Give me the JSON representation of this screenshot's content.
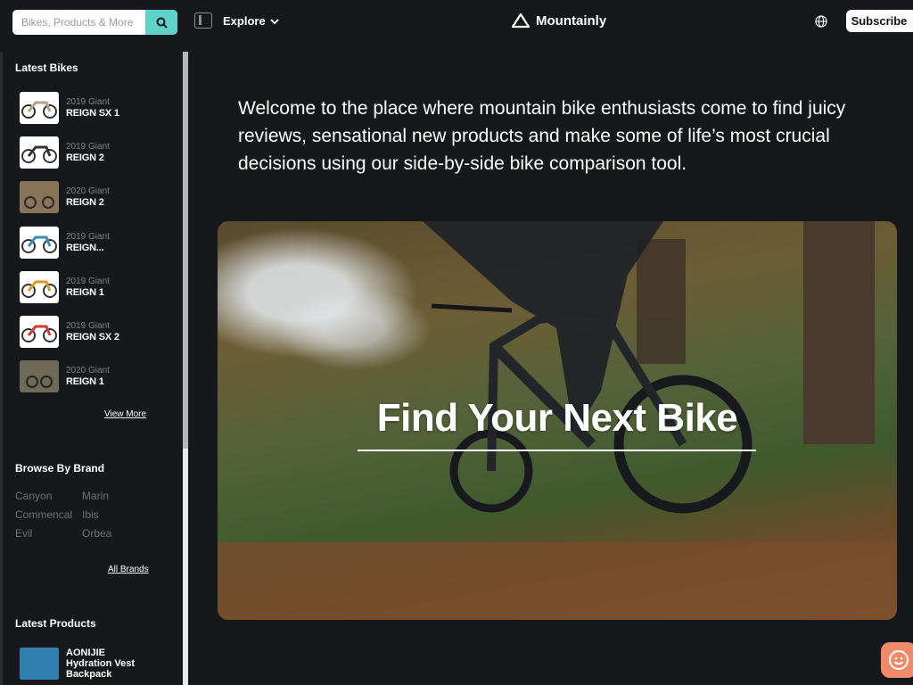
{
  "header": {
    "search_placeholder": "Bikes, Products & More",
    "explore_label": "Explore",
    "brand_name": "Mountainly",
    "subscribe_label": "Subscribe"
  },
  "sidebar": {
    "latest_bikes_title": "Latest Bikes",
    "bikes": [
      {
        "year": "2019 Giant",
        "name": "REIGN SX 1"
      },
      {
        "year": "2019 Giant",
        "name": "REIGN 2"
      },
      {
        "year": "2020 Giant",
        "name": "REIGN 2"
      },
      {
        "year": "2019 Giant",
        "name": "REIGN..."
      },
      {
        "year": "2019 Giant",
        "name": "REIGN 1"
      },
      {
        "year": "2019 Giant",
        "name": "REIGN SX 2"
      },
      {
        "year": "2020 Giant",
        "name": "REIGN 1"
      }
    ],
    "view_more": "View More",
    "browse_brand_title": "Browse By Brand",
    "brands": [
      "Canyon",
      "Marin",
      "Commencal",
      "Ibis",
      "Evil",
      "Orbea"
    ],
    "all_brands": "All Brands",
    "latest_products_title": "Latest Products",
    "product_name": "AONIJIE Hydration Vest Backpack"
  },
  "main": {
    "intro": "Welcome to the place where mountain bike enthusiasts come to find juicy reviews, sensational new products and make some of life’s most crucial decisions using our side-by-side bike comparison tool.",
    "hero_title": "Find Your Next Bike"
  },
  "colors": {
    "background": "#16181c",
    "search_button": "#5fd3c9",
    "chat_button": "#f28a6a"
  },
  "icons": [
    "search-icon",
    "panel-toggle-icon",
    "chevron-down-icon",
    "mountain-logo-icon",
    "globe-icon",
    "chat-smile-icon"
  ]
}
